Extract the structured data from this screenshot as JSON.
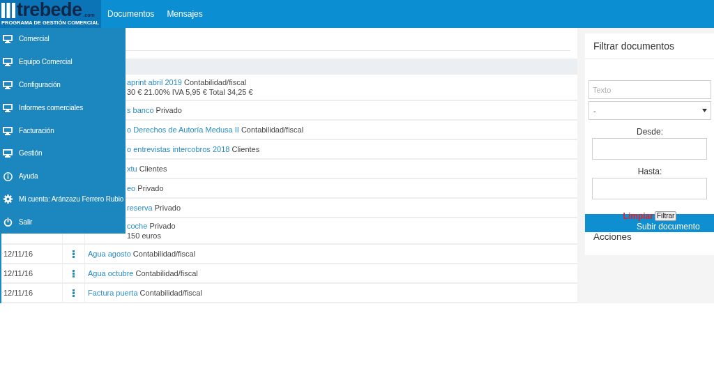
{
  "navbar": {
    "logo": {
      "wordmark": "trebede",
      "domain": ".com",
      "tagline": "PROGRAMA DE GESTIÓN COMERCIAL"
    },
    "links": [
      {
        "label": "Documentos"
      },
      {
        "label": "Mensajes"
      }
    ]
  },
  "menu": {
    "items": [
      {
        "label": "Comercial",
        "kind": "section"
      },
      {
        "label": "Equipo Comercial",
        "kind": "section"
      },
      {
        "label": "Configuración",
        "kind": "section"
      },
      {
        "label": "Informes comerciales",
        "kind": "section"
      },
      {
        "label": "Facturación",
        "kind": "section"
      },
      {
        "label": "Gestión",
        "kind": "section"
      },
      {
        "label": "Ayuda",
        "kind": "help"
      },
      {
        "label": "Mi cuenta: Aránzazu Ferrero Rubio",
        "kind": "account"
      },
      {
        "label": "Salir",
        "kind": "logout"
      }
    ]
  },
  "documents": {
    "rows": [
      {
        "title": "aprint abril 2019",
        "category": "Contabilidad/fiscal",
        "note": "30 € 21.00% IVA 5,95 € Total 34,25 €"
      },
      {
        "title": "s banco",
        "category": "Privado"
      },
      {
        "title": "o Derechos de Autoría Medusa II",
        "category": "Contabilidad/fiscal"
      },
      {
        "title": "o entrevistas intercobros 2018",
        "category": "Clientes"
      },
      {
        "title": "xtu",
        "category": "Clientes"
      },
      {
        "title": "eo",
        "category": "Privado"
      },
      {
        "title": "reserva",
        "category": "Privado"
      },
      {
        "title": "coche",
        "category": "Privado",
        "note": "150 euros"
      },
      {
        "date": "12/11/16",
        "title": "Agua agosto",
        "category": "Contabilidad/fiscal"
      },
      {
        "date": "12/11/16",
        "title": "Agua octubre",
        "category": "Contabilidad/fiscal"
      },
      {
        "date": "12/11/16",
        "title": "Factura puerta",
        "category": "Contabilidad/fiscal"
      }
    ]
  },
  "filter": {
    "title": "Filtrar documentos",
    "text_field": {
      "placeholder": "Texto"
    },
    "type_select": {
      "value": "-"
    },
    "date_from": {
      "label": "Desde:"
    },
    "date_to": {
      "label": "Hasta:"
    },
    "clear_link": "Limpiar",
    "filter_button": "Filtrar"
  },
  "upload_button": {
    "label": "Subir documento"
  },
  "actions": {
    "title": "Acciones"
  }
}
